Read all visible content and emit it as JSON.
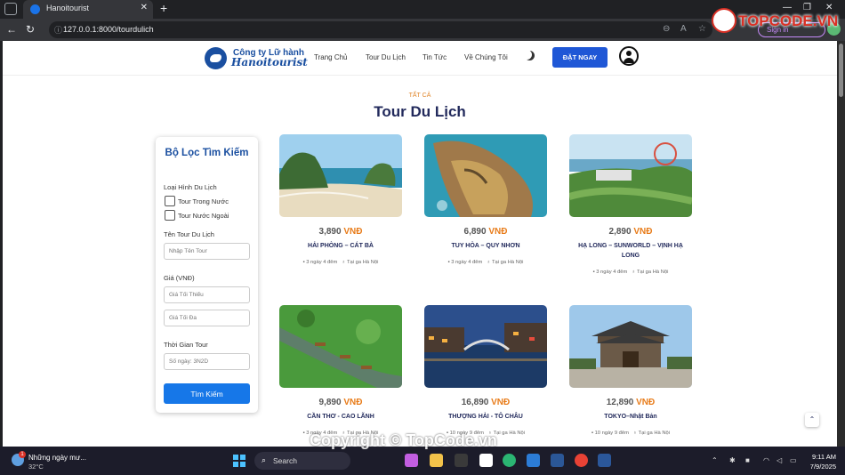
{
  "browser": {
    "tab_title": "Hanoitourist",
    "url": "127.0.0.1:8000/tourdulich",
    "signin_label": "Sign in",
    "watermark_top": "TOPCODE.VN"
  },
  "site": {
    "logo_line1": "Công ty Lữ hành",
    "logo_line2": "Hanoitourist",
    "menu": [
      "Trang Chủ",
      "Tour Du Lịch",
      "Tin Tức",
      "Về Chúng Tôi"
    ],
    "book_label": "ĐẶT NGAY"
  },
  "heading": {
    "eyebrow": "TẤT CẢ",
    "title": "Tour Du Lịch"
  },
  "filter": {
    "title": "Bộ Lọc Tìm Kiếm",
    "type_label": "Loại Hình Du Lịch",
    "domestic_label": "Tour Trong Nước",
    "foreign_label": "Tour Nước Ngoài",
    "name_label": "Tên Tour Du Lịch",
    "name_placeholder": "Nhập Tên Tour",
    "price_label": "Giá (VNĐ)",
    "min_placeholder": "Giá Tối Thiểu",
    "max_placeholder": "Giá Tối Đa",
    "time_label": "Thời Gian Tour",
    "time_placeholder": "Số ngày: 3N2D",
    "search_label": "Tìm Kiếm"
  },
  "tours": [
    {
      "price": "3,890",
      "currency": "VNĐ",
      "name": "HẢI PHÒNG – CÁT BÀ",
      "duration": "3 ngày 4 đêm",
      "depart": "Tại ga Hà Nội"
    },
    {
      "price": "6,890",
      "currency": "VNĐ",
      "name": "TUY HÒA – QUY NHƠN",
      "duration": "3 ngày 4 đêm",
      "depart": "Tại ga Hà Nội"
    },
    {
      "price": "2,890",
      "currency": "VNĐ",
      "name": "HẠ LONG – SUNWORLD – VỊNH HẠ LONG",
      "duration": "3 ngày 4 đêm",
      "depart": "Tại ga Hà Nội"
    },
    {
      "price": "9,890",
      "currency": "VNĐ",
      "name": "CẦN THƠ - CAO LÃNH",
      "duration": "3 ngày 4 đêm",
      "depart": "Tại ga Hà Nội"
    },
    {
      "price": "16,890",
      "currency": "VNĐ",
      "name": "THƯỢNG HẢI - TÔ CHÂU",
      "duration": "10 ngày 9 đêm",
      "depart": "Tại ga Hà Nội"
    },
    {
      "price": "12,890",
      "currency": "VNĐ",
      "name": "TOKYO–Nhật Bản",
      "duration": "10 ngày 9 đêm",
      "depart": "Tại ga Hà Nội"
    }
  ],
  "taskbar": {
    "weather_text": "Những ngày mư...",
    "weather_badge": "1",
    "temperature": "32°C",
    "search_label": "Search",
    "time": "9:11 AM",
    "date": "7/9/2025",
    "watermark": "Copyright © TopCode.vn"
  },
  "colors": {
    "accent": "#1f57d6",
    "title": "#222a5c",
    "price_currency": "#e87c1a"
  }
}
